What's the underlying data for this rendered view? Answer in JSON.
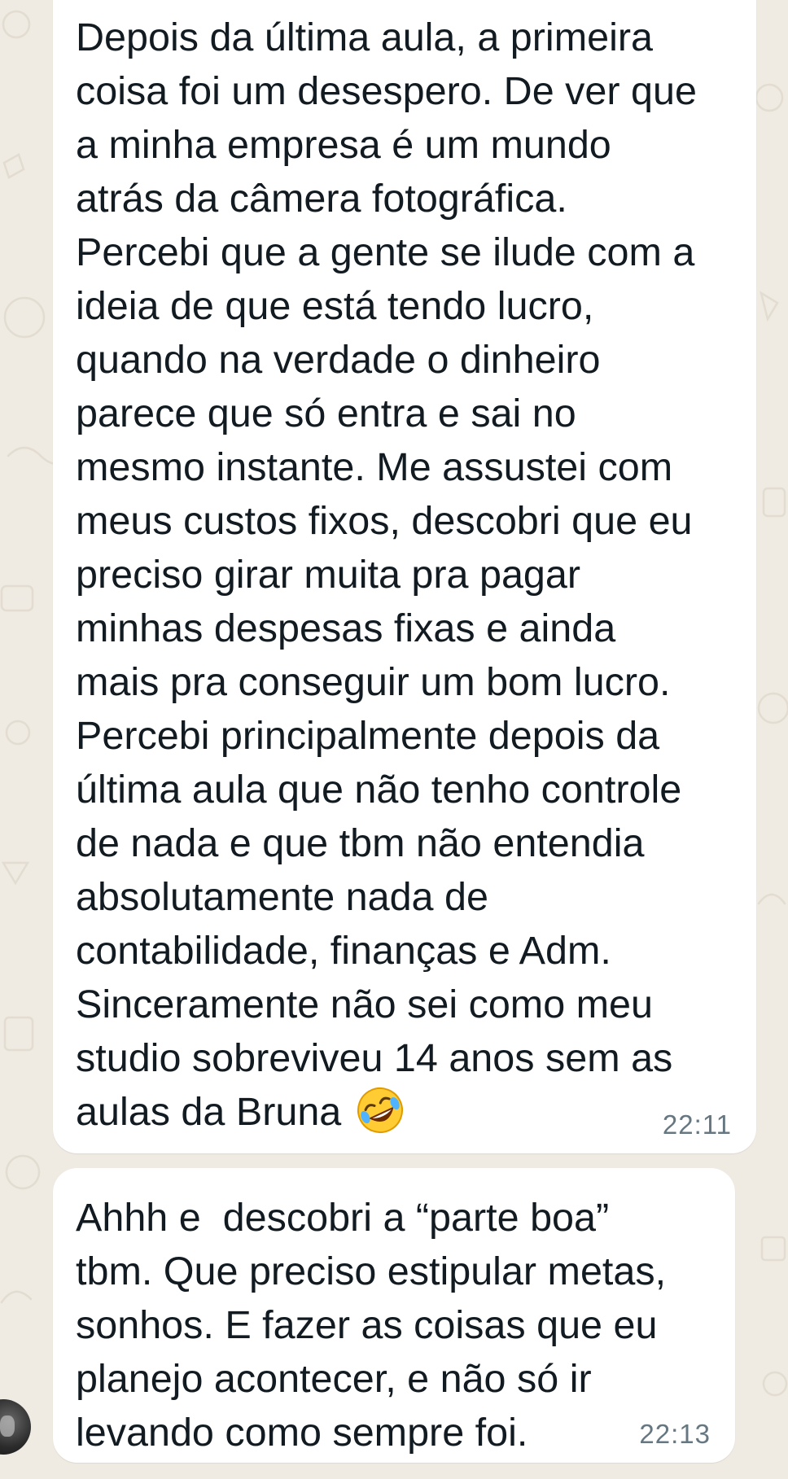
{
  "chat": {
    "messages": [
      {
        "lines": [
          "Depois da última aula, a primeira",
          "coisa foi um desespero. De ver que",
          "a minha empresa é um mundo",
          "atrás da câmera fotográfica.",
          "Percebi que a gente se ilude com a",
          "ideia de que está tendo lucro,",
          "quando na verdade o dinheiro",
          "parece que só entra e sai no",
          "mesmo instante. Me assustei com",
          "meus custos fixos, descobri que eu",
          "preciso girar muita pra pagar",
          "minhas despesas fixas e ainda",
          "mais pra conseguir um bom lucro.",
          "Percebi principalmente depois da",
          "última aula que não tenho controle",
          "de nada e que tbm não entendia",
          "absolutamente nada de",
          "contabilidade, finanças e Adm.",
          "Sinceramente não sei como meu",
          "studio sobreviveu 14 anos sem as",
          "aulas da Bruna"
        ],
        "emoji": "rolling-on-floor-laughing-emoji",
        "time": "22:11"
      },
      {
        "lines": [
          "Ahhh e  descobri a “parte boa”",
          "tbm. Que preciso estipular metas,",
          "sonhos. E fazer as coisas que eu",
          "planejo acontecer, e não só ir",
          "levando como sempre foi."
        ],
        "time": "22:13"
      }
    ]
  },
  "colors": {
    "background": "#efeae2",
    "bubble": "#ffffff",
    "text": "#111b21",
    "time": "#667781"
  }
}
